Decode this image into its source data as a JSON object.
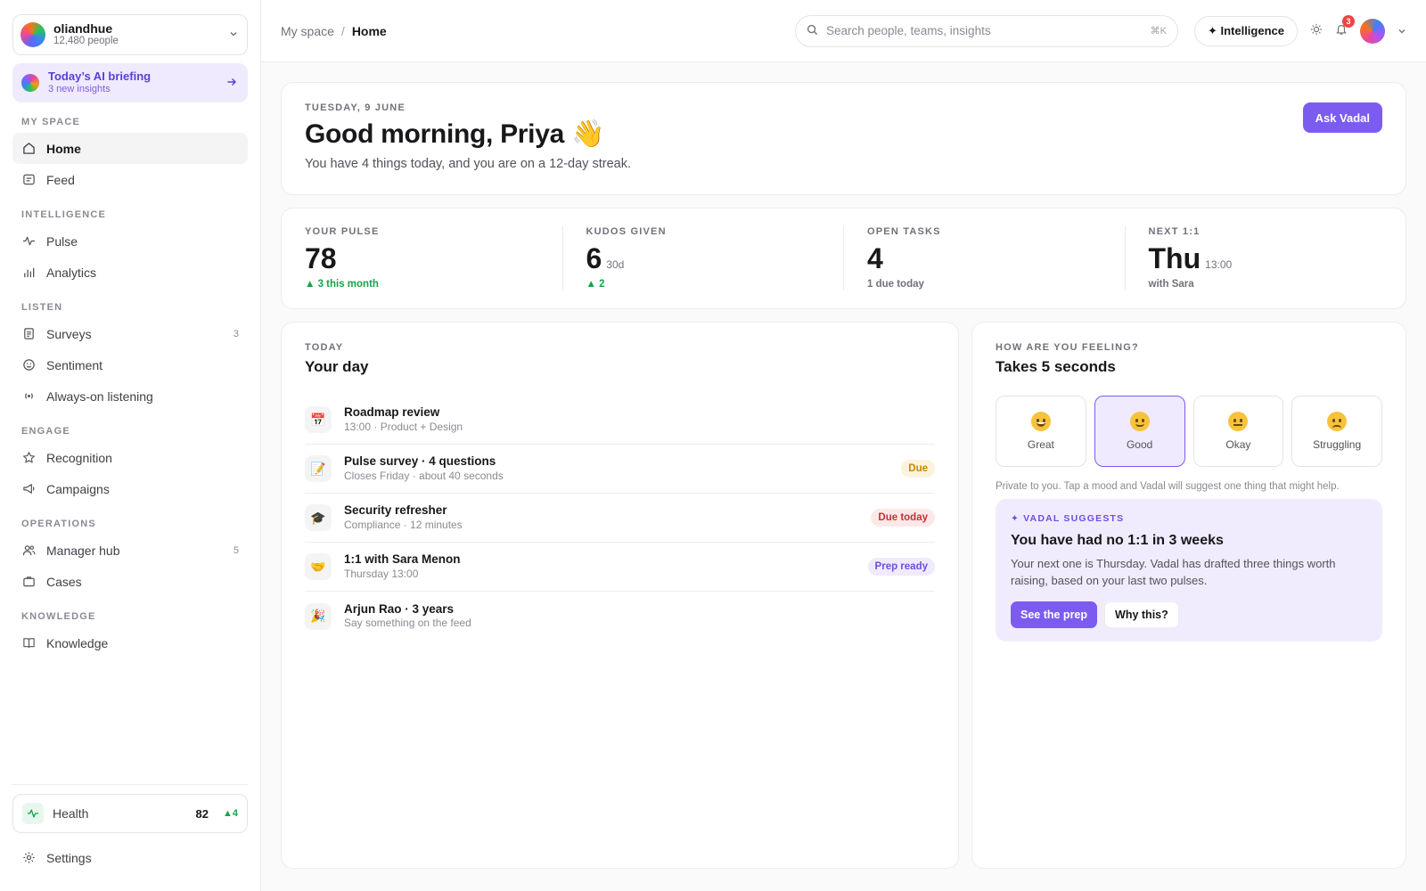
{
  "org": {
    "name": "oliandhue",
    "people": "12,480 people"
  },
  "briefing": {
    "title": "Today’s AI briefing",
    "sub": "3 new insights"
  },
  "nav": {
    "sections": {
      "my_space": "MY SPACE",
      "intelligence": "INTELLIGENCE",
      "listen": "LISTEN",
      "engage": "ENGAGE",
      "operations": "OPERATIONS",
      "knowledge": "KNOWLEDGE"
    },
    "home": "Home",
    "feed": "Feed",
    "pulse": "Pulse",
    "analytics": "Analytics",
    "surveys": "Surveys",
    "surveys_count": "3",
    "sentiment": "Sentiment",
    "listening": "Always-on listening",
    "recognition": "Recognition",
    "campaigns": "Campaigns",
    "manager_hub": "Manager hub",
    "manager_hub_count": "5",
    "cases": "Cases",
    "knowledge": "Knowledge"
  },
  "health": {
    "label": "Health",
    "value": "82",
    "delta": "▲4"
  },
  "settings": "Settings",
  "topbar": {
    "crumb_root": "My space",
    "crumb_sep": "/",
    "crumb_current": "Home",
    "search_placeholder": "Search people, teams, insights",
    "search_kbd": "⌘K",
    "intelligence": "✦ Intelligence",
    "notif_count": "3"
  },
  "hero": {
    "date": "TUESDAY, 9 JUNE",
    "greeting": "Good morning, Priya 👋",
    "sub": "You have 4 things today, and you are on a 12-day streak.",
    "ask": "Ask Vadal"
  },
  "stats": [
    {
      "label": "YOUR PULSE",
      "value": "78",
      "unit": "",
      "sub": "▲ 3 this month"
    },
    {
      "label": "KUDOS GIVEN",
      "value": "6",
      "unit": "30d",
      "sub": "▲ 2"
    },
    {
      "label": "OPEN TASKS",
      "value": "4",
      "unit": "",
      "sub": "1 due today"
    },
    {
      "label": "NEXT 1:1",
      "value": "Thu",
      "unit": "13:00",
      "sub": "with Sara"
    }
  ],
  "day": {
    "eyebrow": "TODAY",
    "title": "Your day",
    "items": [
      {
        "icon": "📅",
        "title": "Roadmap review",
        "sub": "13:00 · Product + Design",
        "pill": ""
      },
      {
        "icon": "📝",
        "title": "Pulse survey · 4 questions",
        "sub": "Closes Friday · about 40 seconds",
        "pill": "Due"
      },
      {
        "icon": "🎓",
        "title": "Security refresher",
        "sub": "Compliance · 12 minutes",
        "pill": "Due today"
      },
      {
        "icon": "🤝",
        "title": "1:1 with Sara Menon",
        "sub": "Thursday 13:00",
        "pill": "Prep ready"
      },
      {
        "icon": "🎉",
        "title": "Arjun Rao · 3 years",
        "sub": "Say something on the feed",
        "pill": ""
      }
    ]
  },
  "feel": {
    "eyebrow": "HOW ARE YOU FEELING?",
    "title": "Takes 5 seconds",
    "moods": [
      "Great",
      "Good",
      "Okay",
      "Struggling"
    ],
    "selected": "Good",
    "private": "Private to you. Tap a mood and Vadal will suggest one thing that might help.",
    "suggest": {
      "eyebrow": "✦ VADAL SUGGESTS",
      "title": "You have had no 1:1 in 3 weeks",
      "body": "Your next one is Thursday. Vadal has drafted three things worth raising, based on your last two pulses.",
      "primary": "See the prep",
      "secondary": "Why this?"
    }
  }
}
